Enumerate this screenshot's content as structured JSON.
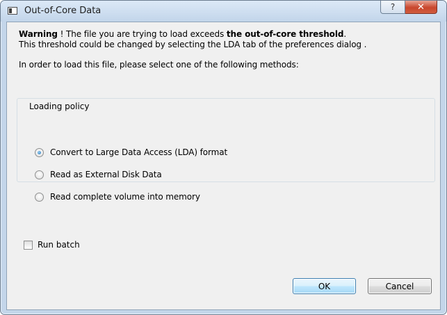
{
  "window": {
    "title": "Out-of-Core Data",
    "help_glyph": "?",
    "close_glyph": "✕"
  },
  "message": {
    "warning_bold": "Warning",
    "warning_mid": " ! The file you are trying to load exceeds ",
    "threshold_bold": "the out-of-core threshold",
    "warning_end": ".",
    "line2": "This threshold could be changed by selecting the LDA tab of the preferences dialog .",
    "line3": "In order to load this file, please select one of the following methods:"
  },
  "loading_policy": {
    "label": "Loading policy",
    "options": [
      {
        "label": "Convert to Large Data Access (LDA) format",
        "checked": true
      },
      {
        "label": "Read as External Disk Data",
        "checked": false
      },
      {
        "label": "Read complete volume into memory",
        "checked": false
      }
    ]
  },
  "run_batch": {
    "label": "Run batch",
    "checked": false
  },
  "buttons": {
    "ok": "OK",
    "cancel": "Cancel"
  },
  "colors": {
    "frame": "#c4d6ea",
    "close_button": "#c8462d",
    "ok_border": "#3c7fb1",
    "radio_dot": "#1f6fb5"
  }
}
